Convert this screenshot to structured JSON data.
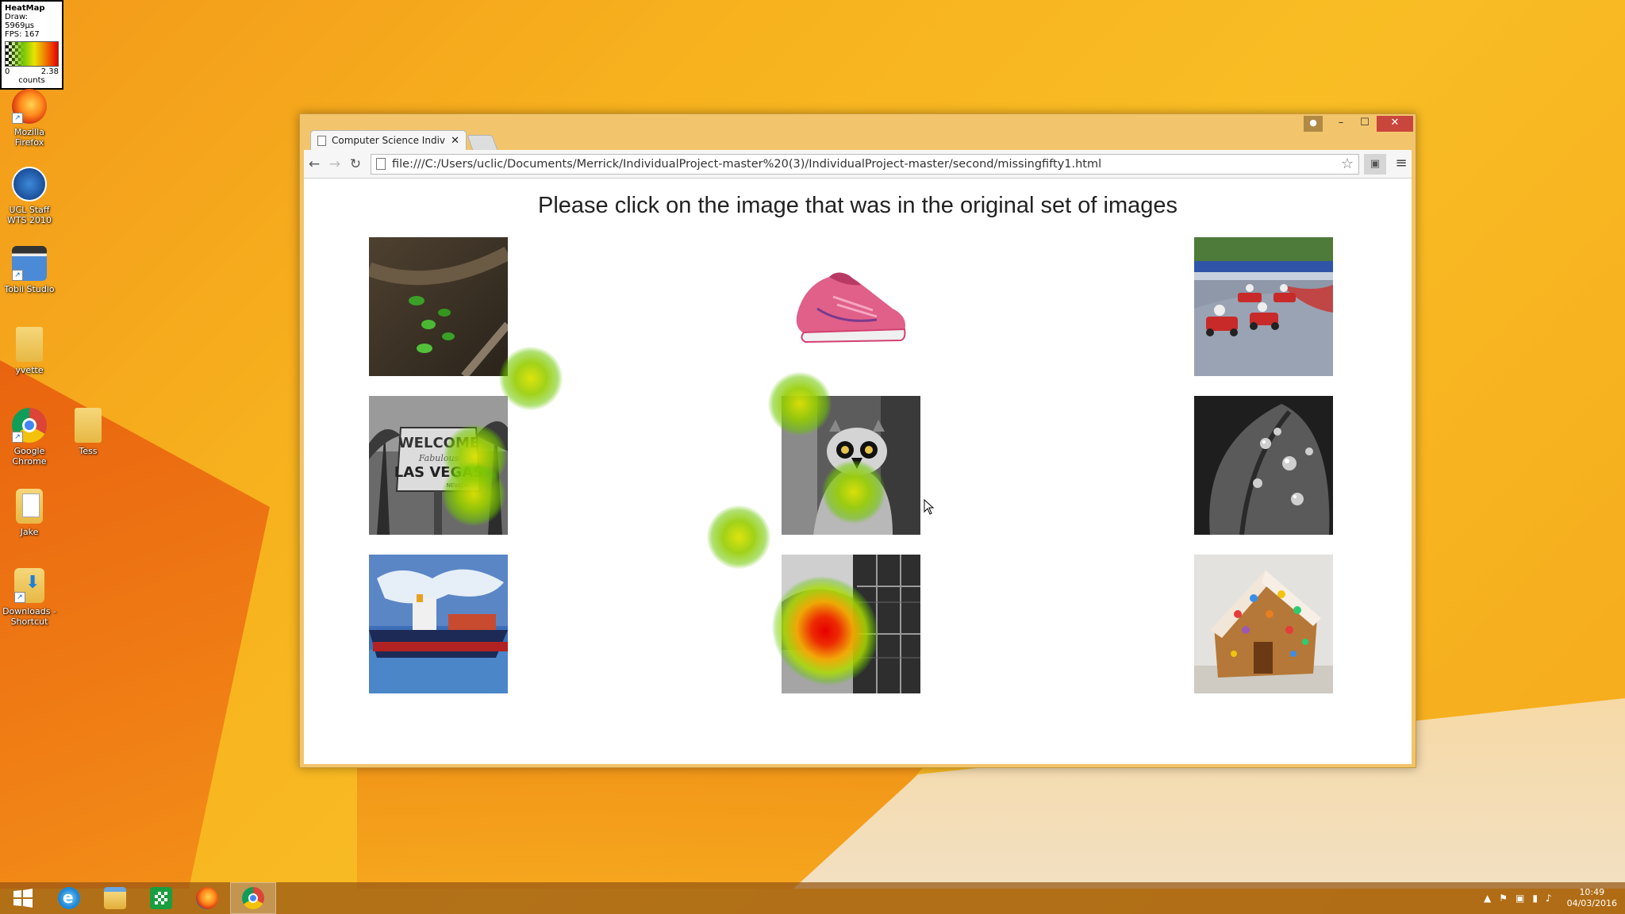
{
  "heatmap_legend": {
    "title": "HeatMap",
    "draw": "Draw: 5969µs",
    "fps": "FPS: 167",
    "min": "0",
    "max": "2.38",
    "units": "counts"
  },
  "desktop": {
    "icons": [
      {
        "label": "Mozilla Firefox",
        "icon": "firefox-icon"
      },
      {
        "label": "UCL Staff WTS 2010",
        "icon": "remote-desktop-icon"
      },
      {
        "label": "Tobii Studio",
        "icon": "tobii-studio-icon"
      },
      {
        "label": "yvette",
        "icon": "folder-icon"
      },
      {
        "label": "Google Chrome",
        "icon": "chrome-icon"
      },
      {
        "label": "Tess",
        "icon": "folder-icon"
      },
      {
        "label": "Jake",
        "icon": "folder-icon"
      },
      {
        "label": "Downloads - Shortcut",
        "icon": "downloads-folder-icon"
      }
    ]
  },
  "browser": {
    "tab_title": "Computer Science Individ",
    "url": "file:///C:/Users/uclic/Documents/Merrick/IndividualProject-master%20(3)/IndividualProject-master/second/missingfifty1.html",
    "controls": {
      "minimize": "–",
      "maximize": "☐",
      "close": "✕"
    }
  },
  "page": {
    "prompt": "Please click on the image that was in the original set of images",
    "images": [
      {
        "name": "image-insects-on-branch",
        "subject": "green beetles on branch"
      },
      {
        "name": "image-pink-sneaker",
        "subject": "pink running shoe"
      },
      {
        "name": "image-go-karts",
        "subject": "go-kart race"
      },
      {
        "name": "image-las-vegas-sign",
        "subject": "Welcome to Las Vegas sign"
      },
      {
        "name": "image-lemur",
        "subject": "lemur on tree"
      },
      {
        "name": "image-water-drops-leaf",
        "subject": "leaf with water drops"
      },
      {
        "name": "image-cargo-ship",
        "subject": "cargo ship"
      },
      {
        "name": "image-building-balcony",
        "subject": "building with balconies"
      },
      {
        "name": "image-gingerbread-house",
        "subject": "gingerbread house"
      }
    ],
    "sign_text": {
      "welcome": "WELCOME",
      "fab": "Fabulous",
      "vegas": "LAS VEGAS",
      "nevada": "NEVADA"
    }
  },
  "taskbar": {
    "apps": [
      "start-icon",
      "internet-explorer-icon",
      "file-explorer-icon",
      "store-icon",
      "firefox-icon",
      "chrome-icon"
    ],
    "time": "10:49",
    "date": "04/03/2016"
  },
  "colors": {
    "heat_green": "#8fd400",
    "heat_red": "#e80000",
    "close_button": "#c9463d",
    "window_frame": "#f2c56c"
  }
}
